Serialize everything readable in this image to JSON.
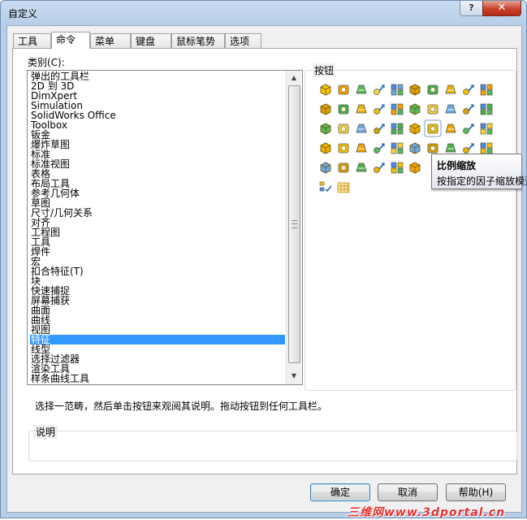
{
  "window": {
    "title": "自定义",
    "help_glyph": "?",
    "close_glyph": "✕"
  },
  "tabs": [
    "工具栏",
    "命令",
    "菜单",
    "键盘",
    "鼠标笔势",
    "选项"
  ],
  "active_tab": "命令",
  "categories": {
    "label": "类别(C):",
    "items": [
      "弹出的工具栏",
      "2D 到 3D",
      "DimXpert",
      "Simulation",
      "SolidWorks Office",
      "Toolbox",
      "钣金",
      "爆炸草图",
      "标准",
      "标准视图",
      "表格",
      "布局工具",
      "参考几何体",
      "草图",
      "尺寸/几何关系",
      "对齐",
      "工程图",
      "工具",
      "焊件",
      "宏",
      "扣合特征(T)",
      "块",
      "快速捕捉",
      "屏幕捕获",
      "曲面",
      "曲线",
      "视图",
      "特征",
      "线型",
      "选择过滤器",
      "渲染工具",
      "样条曲线工具"
    ],
    "selected": "特征"
  },
  "buttons_group": {
    "label": "按钮",
    "icons": [
      "extruded-boss-icon",
      "revolved-boss-icon",
      "swept-boss-icon",
      "lofted-boss-icon",
      "boundary-boss-icon",
      "extruded-cut-icon",
      "hole-wizard-icon",
      "revolved-cut-icon",
      "swept-cut-icon",
      "lofted-cut-icon",
      "boundary-cut-icon",
      "fillet-icon",
      "chamfer-icon",
      "rib-icon",
      "draft-icon",
      "shell-icon",
      "wrap-icon",
      "dome-icon",
      "freeform-icon",
      "deform-icon",
      "indent-icon",
      "flex-icon",
      "combine-icon",
      "move-face-icon",
      "split-line-icon",
      "intersect-icon",
      "scale-icon",
      "thicken-icon",
      "cosmetic-thread-icon",
      "hole-series-icon",
      "linear-pattern-icon",
      "circular-pattern-icon",
      "mirror-icon",
      "curve-driven-pattern-icon",
      "sketch-driven-pattern-icon",
      "table-driven-pattern-icon",
      "fill-pattern-icon",
      "delete-body-icon",
      "point-pattern-icon",
      "feature-table-icon",
      "library-feature-icon",
      "move-copy-body-icon",
      "insert-part-icon",
      "join-icon",
      "delete-face-icon",
      "curve-icon",
      "checklist-icon",
      "3d-grid-icon"
    ]
  },
  "tooltip": {
    "title": "比例缩放",
    "description": "按指定的因子缩放模型"
  },
  "hint": "选择一范畴，然后单击按钮来观阅其说明。拖动按钮到任何工具栏。",
  "description_group": {
    "label": "说明"
  },
  "buttons": {
    "ok": "确定",
    "cancel": "取消",
    "help": "帮助(H)"
  },
  "watermark": "三维网www.3dportal.cn",
  "colors": {
    "selection": "#3399ff",
    "title_bar": "#b9cde6",
    "close": "#c8412c",
    "watermark": "#e83030"
  }
}
